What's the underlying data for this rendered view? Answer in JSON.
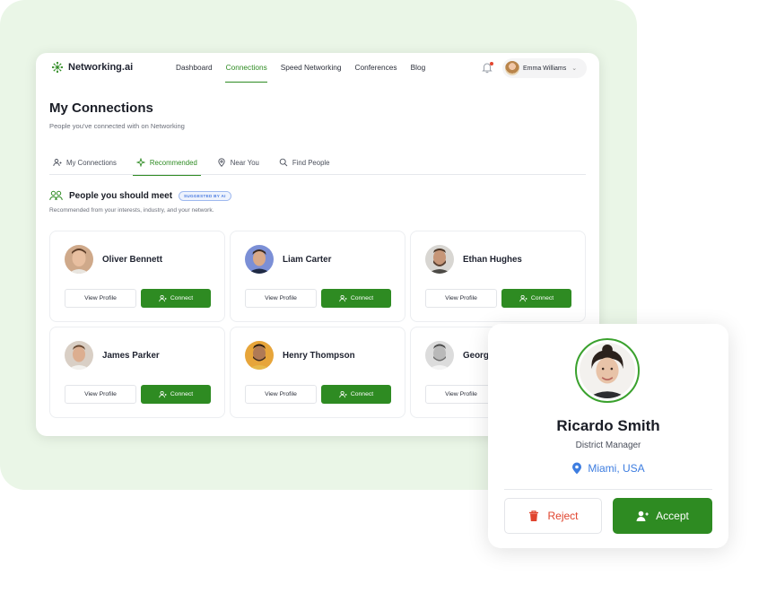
{
  "brand": {
    "name": "Networking.ai",
    "accent": "#2e8b22"
  },
  "nav": {
    "links": [
      "Dashboard",
      "Connections",
      "Speed Networking",
      "Conferences",
      "Blog"
    ],
    "active": "Connections",
    "user_name": "Emma Williams"
  },
  "page": {
    "title": "My Connections",
    "subtitle": "People you've connected with on Networking"
  },
  "tabs": [
    {
      "label": "My Connections",
      "icon": "user-icon"
    },
    {
      "label": "Recommended",
      "icon": "sparkle-icon"
    },
    {
      "label": "Near You",
      "icon": "pin-icon"
    },
    {
      "label": "Find People",
      "icon": "search-icon"
    }
  ],
  "section": {
    "title": "People you should meet",
    "badge": "SUGGESTED BY AI",
    "subtitle": "Recommended from your interests, industry, and your network."
  },
  "cards": {
    "view_label": "View Profile",
    "connect_label": "Connect",
    "people": [
      {
        "name": "Oliver Bennett"
      },
      {
        "name": "Liam Carter"
      },
      {
        "name": "Ethan Hughes"
      },
      {
        "name": "James Parker"
      },
      {
        "name": "Henry Thompson"
      },
      {
        "name": "Georg"
      }
    ]
  },
  "request": {
    "name": "Ricardo Smith",
    "role": "District Manager",
    "location": "Miami, USA",
    "reject_label": "Reject",
    "accept_label": "Accept"
  }
}
